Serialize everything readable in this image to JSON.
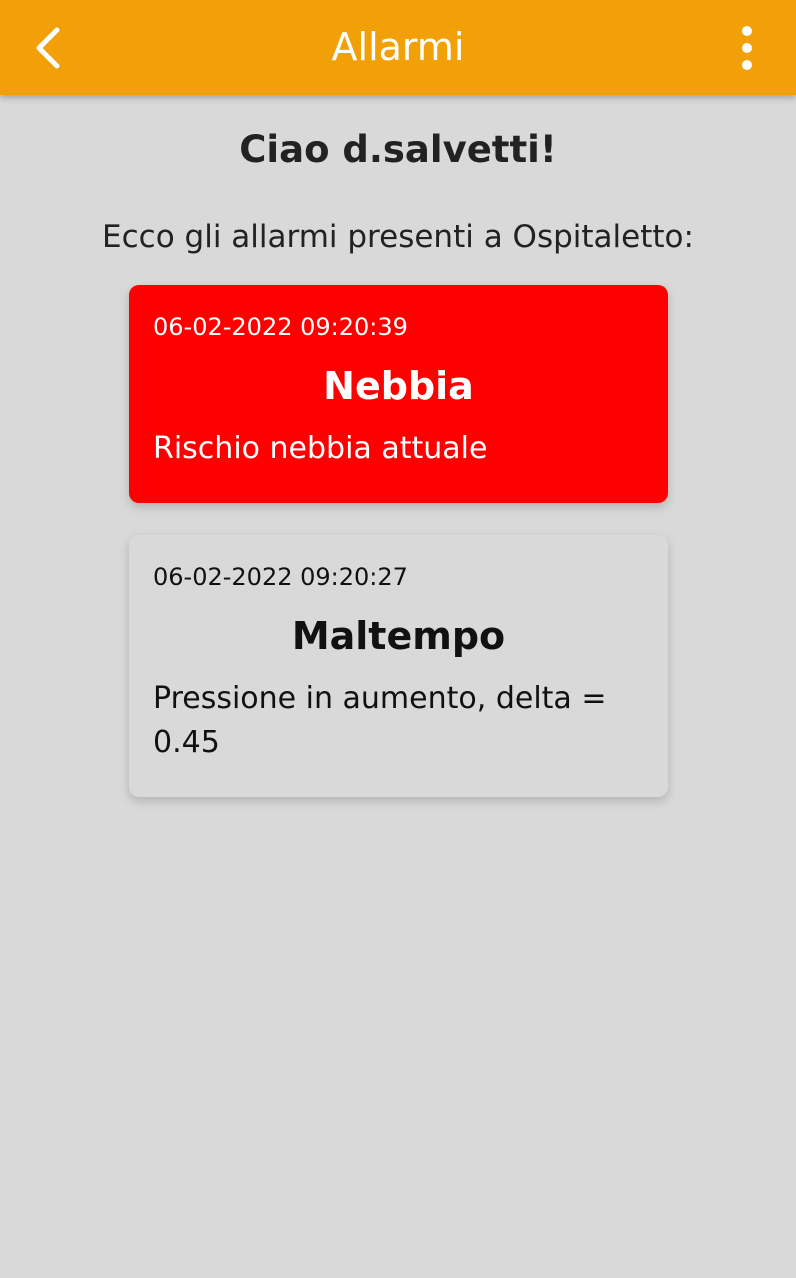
{
  "app_bar": {
    "title": "Allarmi",
    "back_icon": "chevron-left-icon",
    "menu_icon": "more-vertical-icon",
    "color": "#f2a007"
  },
  "greeting": "Ciao d.salvetti!",
  "intro": "Ecco gli allarmi presenti a Ospitaletto:",
  "alarms": [
    {
      "timestamp": "06-02-2022 09:20:39",
      "title": "Nebbia",
      "description": "Rischio nebbia attuale",
      "color": "#ff0000"
    },
    {
      "timestamp": "06-02-2022 09:20:27",
      "title": "Maltempo",
      "description": "Pressione in aumento, delta = 0.45",
      "color": "#d9d9d9"
    }
  ]
}
